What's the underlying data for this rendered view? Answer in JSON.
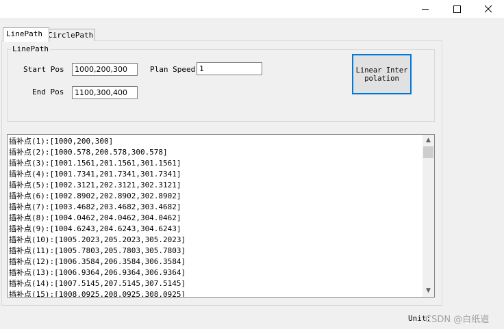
{
  "tabs": [
    {
      "label": "LinePath",
      "active": true
    },
    {
      "label": "CirclePath",
      "active": false
    }
  ],
  "group": {
    "title": "LinePath"
  },
  "form": {
    "start_label": "Start Pos",
    "start_value": "1000,200,300",
    "end_label": "End Pos",
    "end_value": "1100,300,400",
    "speed_label": "Plan Speed",
    "speed_value": "1"
  },
  "button": {
    "linear_label": "Linear Interpolation"
  },
  "output": {
    "rows": [
      "插补点(1):[1000,200,300]",
      "插补点(2):[1000.578,200.578,300.578]",
      "插补点(3):[1001.1561,201.1561,301.1561]",
      "插补点(4):[1001.7341,201.7341,301.7341]",
      "插补点(5):[1002.3121,202.3121,302.3121]",
      "插补点(6):[1002.8902,202.8902,302.8902]",
      "插补点(7):[1003.4682,203.4682,303.4682]",
      "插补点(8):[1004.0462,204.0462,304.0462]",
      "插补点(9):[1004.6243,204.6243,304.6243]",
      "插补点(10):[1005.2023,205.2023,305.2023]",
      "插补点(11):[1005.7803,205.7803,305.7803]",
      "插补点(12):[1006.3584,206.3584,306.3584]",
      "插补点(13):[1006.9364,206.9364,306.9364]",
      "插补点(14):[1007.5145,207.5145,307.5145]",
      "插补点(15):[1008.0925,208.0925,308.0925]"
    ]
  },
  "status": {
    "unit_label": "Unit:"
  },
  "watermark": "CSDN @白纸道",
  "icons": {
    "minimize": "minimize-icon",
    "maximize": "maximize-icon",
    "close": "close-icon",
    "scroll_up": "chevron-up-icon",
    "scroll_down": "chevron-down-icon"
  },
  "colors": {
    "focus_border": "#0078d7",
    "window_bg": "#f0f0f0"
  }
}
